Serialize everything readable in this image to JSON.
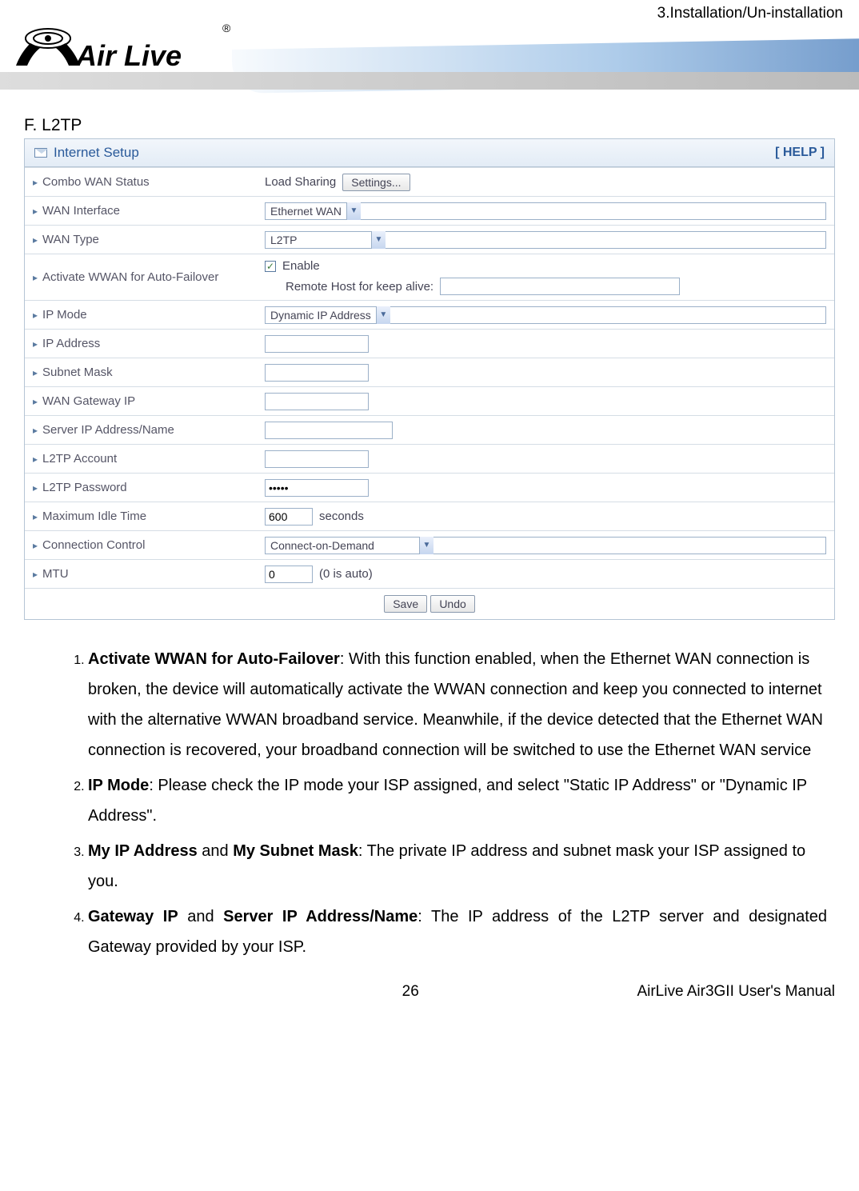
{
  "header": {
    "right_text": "3.Installation/Un-installation",
    "logo_text": "Air Live",
    "logo_r": "®"
  },
  "section_title": "F. L2TP",
  "panel": {
    "title": "Internet Setup",
    "help": "[ HELP ]",
    "rows": {
      "combo_wan_status": "Combo WAN Status",
      "load_sharing": "Load Sharing",
      "settings_btn": "Settings...",
      "wan_interface": "WAN Interface",
      "wan_interface_val": "Ethernet WAN",
      "wan_type": "WAN Type",
      "wan_type_val": "L2TP",
      "activate_wwan": "Activate WWAN for Auto-Failover",
      "enable": "Enable",
      "remote_host": "Remote Host for keep alive:",
      "remote_host_val": "",
      "ip_mode": "IP Mode",
      "ip_mode_val": "Dynamic IP Address",
      "ip_address": "IP Address",
      "ip_address_val": "",
      "subnet_mask": "Subnet Mask",
      "subnet_mask_val": "",
      "wan_gateway": "WAN Gateway IP",
      "wan_gateway_val": "",
      "server_ip": "Server IP Address/Name",
      "server_ip_val": "",
      "l2tp_account": "L2TP Account",
      "l2tp_account_val": "",
      "l2tp_password": "L2TP Password",
      "l2tp_password_val": "•••••",
      "max_idle": "Maximum Idle Time",
      "max_idle_val": "600",
      "seconds": "seconds",
      "conn_ctrl": "Connection Control",
      "conn_ctrl_val": "Connect-on-Demand",
      "mtu": "MTU",
      "mtu_val": "0",
      "mtu_note": "(0 is auto)",
      "save": "Save",
      "undo": "Undo"
    }
  },
  "desc": {
    "item1_bold": "Activate WWAN for Auto-Failover",
    "item1_text": ": With this function enabled, when the Ethernet WAN connection is broken, the device will automatically activate the WWAN connection and keep you connected to internet with the alternative WWAN broadband service. Meanwhile, if the device detected that the Ethernet WAN connection is recovered, your broadband connection will be switched to use the Ethernet WAN service",
    "item2_bold": "IP Mode",
    "item2_text": ": Please check the IP mode your ISP assigned, and select \"Static IP Address\" or \"Dynamic IP Address\".",
    "item3_bold1": "My IP Address",
    "item3_mid": " and ",
    "item3_bold2": "My Subnet Mask",
    "item3_text": ": The private IP address and subnet mask your ISP assigned to you.",
    "item4_bold1": "Gateway IP",
    "item4_mid": " and ",
    "item4_bold2": "Server IP Address/Name",
    "item4_text": ": The IP address of the L2TP server and designated Gateway provided by your ISP."
  },
  "footer": {
    "page": "26",
    "manual": "AirLive Air3GII User's Manual"
  }
}
